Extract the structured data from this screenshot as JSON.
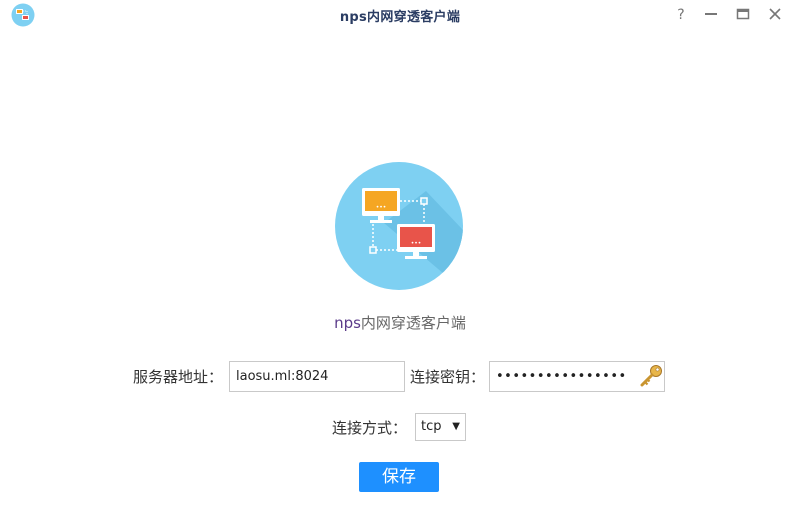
{
  "window": {
    "title": "nps内网穿透客户端",
    "controls": {
      "help": "?",
      "minimize": "minimize",
      "maximize": "maximize",
      "close": "close"
    }
  },
  "logo": {
    "icon": "network-computers-icon",
    "circle_color": "#7ed0f2",
    "screen1_color": "#f5a623",
    "screen2_color": "#e8544a"
  },
  "subtitle": {
    "prefix": "nps",
    "rest": "内网穿透客户端"
  },
  "form": {
    "server_label": "服务器地址：",
    "server_value": "laosu.ml:8024",
    "key_label": "连接密钥：",
    "key_value": "••••••••••••••••",
    "key_icon": "key-icon",
    "mode_label": "连接方式：",
    "mode_value": "tcp",
    "mode_arrow": "▼"
  },
  "save_button": "保存",
  "colors": {
    "accent": "#1e90ff",
    "title": "#2b3d63"
  }
}
